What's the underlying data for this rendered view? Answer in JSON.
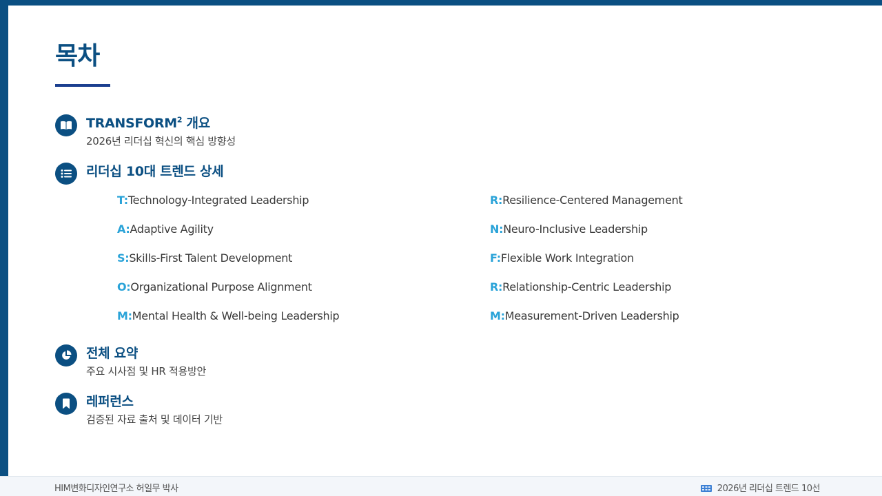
{
  "page": {
    "title": "목차"
  },
  "sections": [
    {
      "icon": "book-open-icon",
      "heading": "TRANSFORM",
      "heading_sup": "2",
      "heading_suffix": " 개요",
      "subtitle": "2026년 리더십 혁신의 핵심 방향성"
    },
    {
      "icon": "list-icon",
      "heading": "리더십 10대 트렌드 상세"
    },
    {
      "icon": "pie-chart-icon",
      "heading": "전체 요약",
      "subtitle": "주요 시사점 및 HR 적용방안"
    },
    {
      "icon": "bookmark-icon",
      "heading": "레퍼런스",
      "subtitle": "검증된 자료 출처 및 데이터 기반"
    }
  ],
  "trends": {
    "left": [
      {
        "letter": "T:",
        "text": "Technology-Integrated Leadership"
      },
      {
        "letter": "A:",
        "text": "Adaptive Agility"
      },
      {
        "letter": "S:",
        "text": "Skills-First Talent Development"
      },
      {
        "letter": "O:",
        "text": "Organizational Purpose Alignment"
      },
      {
        "letter": "M:",
        "text": "Mental Health & Well-being Leadership"
      }
    ],
    "right": [
      {
        "letter": "R:",
        "text": "Resilience-Centered Management"
      },
      {
        "letter": "N:",
        "text": "Neuro-Inclusive Leadership"
      },
      {
        "letter": "F:",
        "text": "Flexible Work Integration"
      },
      {
        "letter": "R:",
        "text": "Relationship-Centric Leadership"
      },
      {
        "letter": "M:",
        "text": "Measurement-Driven Leadership"
      }
    ]
  },
  "footer": {
    "left": "HIM변화디자인연구소 허일무 박사",
    "right": "2026년 리더십 트렌드 10선",
    "right_icon": "table-icon"
  },
  "colors": {
    "primary": "#0b4f82",
    "accent": "#2aa3d8",
    "footer_icon": "#3b7fd4"
  }
}
